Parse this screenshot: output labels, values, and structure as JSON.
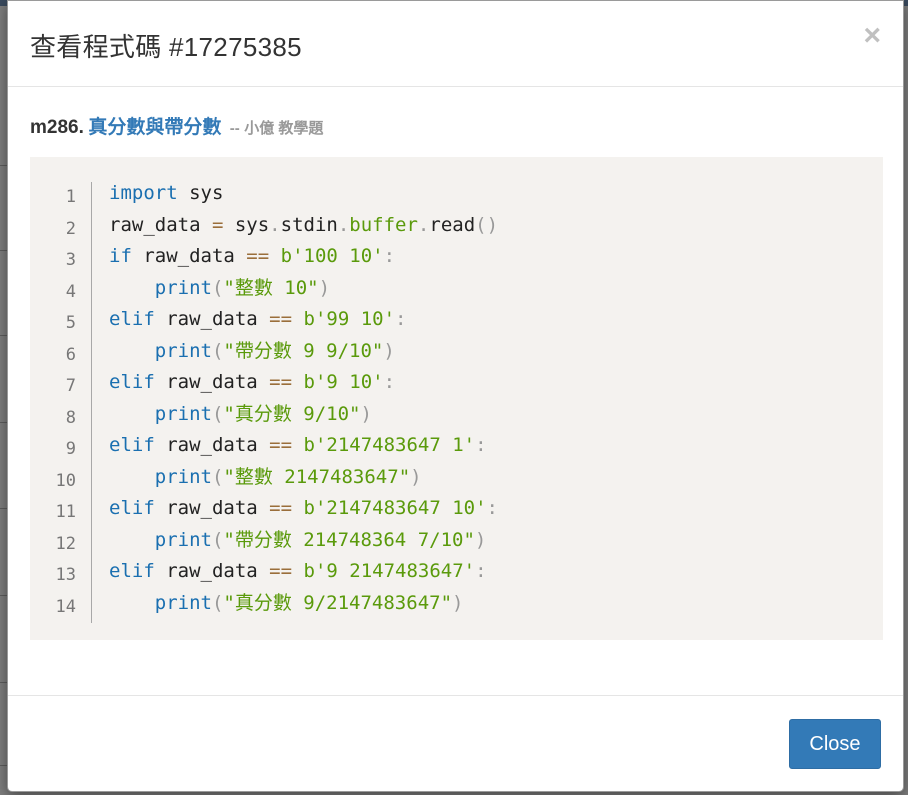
{
  "modal": {
    "title": "查看程式碼 #17275385",
    "close_symbol": "×"
  },
  "problem": {
    "id": "m286.",
    "name": "真分數與帶分數",
    "separator": "--",
    "author": "小億 教學題"
  },
  "code": {
    "line_numbers": [
      "1",
      "2",
      "3",
      "4",
      "5",
      "6",
      "7",
      "8",
      "9",
      "10",
      "11",
      "12",
      "13",
      "14"
    ],
    "lines": [
      [
        {
          "t": "import",
          "c": "kw"
        },
        {
          "t": " sys",
          "c": ""
        }
      ],
      [
        {
          "t": "raw_data ",
          "c": ""
        },
        {
          "t": "=",
          "c": "op"
        },
        {
          "t": " sys",
          "c": ""
        },
        {
          "t": ".",
          "c": "punct"
        },
        {
          "t": "stdin",
          "c": ""
        },
        {
          "t": ".",
          "c": "punct"
        },
        {
          "t": "buffer",
          "c": "attr"
        },
        {
          "t": ".",
          "c": "punct"
        },
        {
          "t": "read",
          "c": ""
        },
        {
          "t": "()",
          "c": "punct"
        }
      ],
      [
        {
          "t": "if",
          "c": "kw"
        },
        {
          "t": " raw_data ",
          "c": ""
        },
        {
          "t": "==",
          "c": "op"
        },
        {
          "t": " ",
          "c": ""
        },
        {
          "t": "b'100 10'",
          "c": "str"
        },
        {
          "t": ":",
          "c": "punct"
        }
      ],
      [
        {
          "t": "    ",
          "c": ""
        },
        {
          "t": "print",
          "c": "fn"
        },
        {
          "t": "(",
          "c": "punct"
        },
        {
          "t": "\"整數 10\"",
          "c": "str"
        },
        {
          "t": ")",
          "c": "punct"
        }
      ],
      [
        {
          "t": "elif",
          "c": "kw"
        },
        {
          "t": " raw_data ",
          "c": ""
        },
        {
          "t": "==",
          "c": "op"
        },
        {
          "t": " ",
          "c": ""
        },
        {
          "t": "b'99 10'",
          "c": "str"
        },
        {
          "t": ":",
          "c": "punct"
        }
      ],
      [
        {
          "t": "    ",
          "c": ""
        },
        {
          "t": "print",
          "c": "fn"
        },
        {
          "t": "(",
          "c": "punct"
        },
        {
          "t": "\"帶分數 9 9/10\"",
          "c": "str"
        },
        {
          "t": ")",
          "c": "punct"
        }
      ],
      [
        {
          "t": "elif",
          "c": "kw"
        },
        {
          "t": " raw_data ",
          "c": ""
        },
        {
          "t": "==",
          "c": "op"
        },
        {
          "t": " ",
          "c": ""
        },
        {
          "t": "b'9 10'",
          "c": "str"
        },
        {
          "t": ":",
          "c": "punct"
        }
      ],
      [
        {
          "t": "    ",
          "c": ""
        },
        {
          "t": "print",
          "c": "fn"
        },
        {
          "t": "(",
          "c": "punct"
        },
        {
          "t": "\"真分數 9/10\"",
          "c": "str"
        },
        {
          "t": ")",
          "c": "punct"
        }
      ],
      [
        {
          "t": "elif",
          "c": "kw"
        },
        {
          "t": " raw_data ",
          "c": ""
        },
        {
          "t": "==",
          "c": "op"
        },
        {
          "t": " ",
          "c": ""
        },
        {
          "t": "b'2147483647 1'",
          "c": "str"
        },
        {
          "t": ":",
          "c": "punct"
        }
      ],
      [
        {
          "t": "    ",
          "c": ""
        },
        {
          "t": "print",
          "c": "fn"
        },
        {
          "t": "(",
          "c": "punct"
        },
        {
          "t": "\"整數 2147483647\"",
          "c": "str"
        },
        {
          "t": ")",
          "c": "punct"
        }
      ],
      [
        {
          "t": "elif",
          "c": "kw"
        },
        {
          "t": " raw_data ",
          "c": ""
        },
        {
          "t": "==",
          "c": "op"
        },
        {
          "t": " ",
          "c": ""
        },
        {
          "t": "b'2147483647 10'",
          "c": "str"
        },
        {
          "t": ":",
          "c": "punct"
        }
      ],
      [
        {
          "t": "    ",
          "c": ""
        },
        {
          "t": "print",
          "c": "fn"
        },
        {
          "t": "(",
          "c": "punct"
        },
        {
          "t": "\"帶分數 214748364 7/10\"",
          "c": "str"
        },
        {
          "t": ")",
          "c": "punct"
        }
      ],
      [
        {
          "t": "elif",
          "c": "kw"
        },
        {
          "t": " raw_data ",
          "c": ""
        },
        {
          "t": "==",
          "c": "op"
        },
        {
          "t": " ",
          "c": ""
        },
        {
          "t": "b'9 2147483647'",
          "c": "str"
        },
        {
          "t": ":",
          "c": "punct"
        }
      ],
      [
        {
          "t": "    ",
          "c": ""
        },
        {
          "t": "print",
          "c": "fn"
        },
        {
          "t": "(",
          "c": "punct"
        },
        {
          "t": "\"真分數 9/2147483647\"",
          "c": "str"
        },
        {
          "t": ")",
          "c": "punct"
        }
      ]
    ]
  },
  "footer": {
    "close_label": "Close"
  },
  "colors": {
    "accent": "#337ab7",
    "code_background": "#f4f2ef",
    "keyword": "#1a6fb0",
    "string": "#5a9a0b"
  }
}
